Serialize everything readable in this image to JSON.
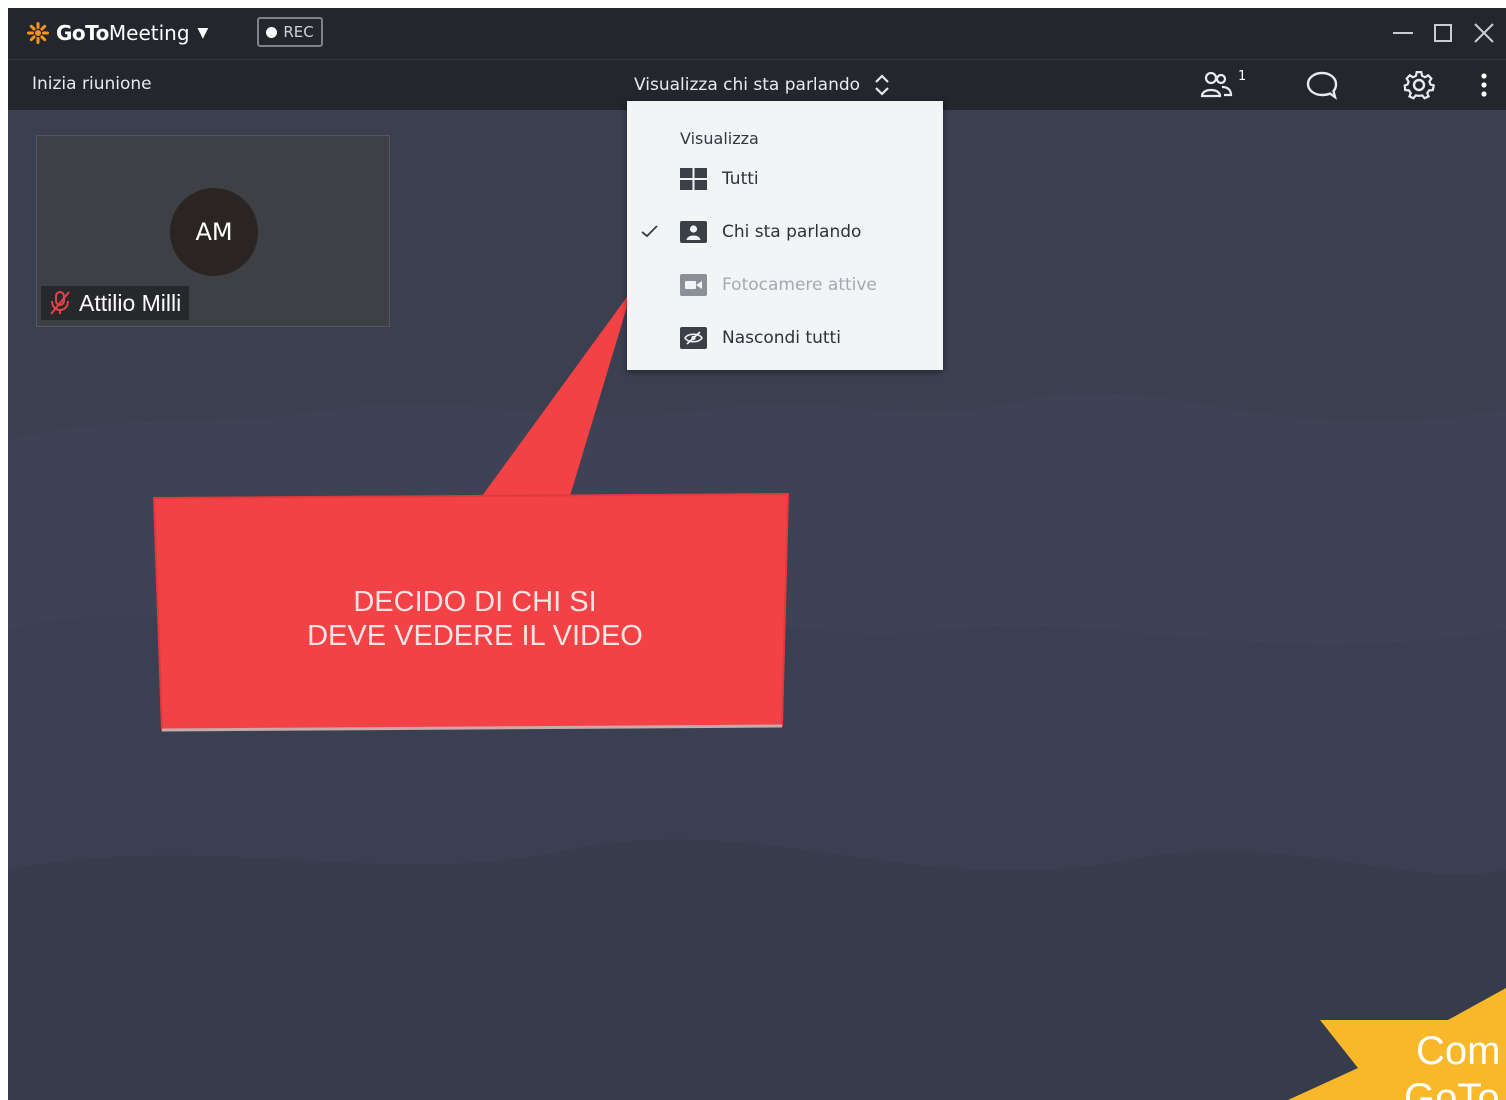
{
  "app": {
    "logo_goto": "GoTo",
    "logo_meeting": "Meeting",
    "rec_label": "REC"
  },
  "toolbar": {
    "start_meeting": "Inizia riunione",
    "view_selector": "Visualizza chi sta parlando",
    "attendees_count": "1"
  },
  "participant": {
    "initials": "AM",
    "name": "Attilio Milli",
    "muted": true
  },
  "view_menu": {
    "header": "Visualizza",
    "items": [
      {
        "label": "Tutti",
        "icon": "grid-icon",
        "checked": false,
        "disabled": false
      },
      {
        "label": "Chi sta parlando",
        "icon": "person-icon",
        "checked": true,
        "disabled": false
      },
      {
        "label": "Fotocamere attive",
        "icon": "camera-icon",
        "checked": false,
        "disabled": true
      },
      {
        "label": "Nascondi tutti",
        "icon": "hidden-eye-icon",
        "checked": false,
        "disabled": false
      }
    ]
  },
  "callout": {
    "line1": "DECIDO DI CHI SI",
    "line2": "DEVE VEDERE IL VIDEO"
  },
  "corner_banner": {
    "line1": "Com",
    "line2": "GoTo"
  },
  "colors": {
    "titlebar": "#23262c",
    "stage": "#3b4050",
    "accent_orange": "#f7941d",
    "callout_red": "#f24245",
    "banner_yellow": "#f8b829",
    "mic_red": "#e4424a"
  }
}
